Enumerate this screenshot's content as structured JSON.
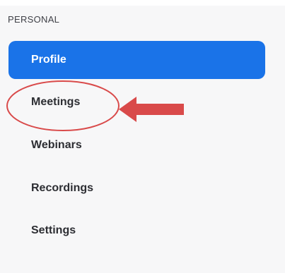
{
  "top_strip": {
    "faded_text": "··· · ········· ·· ··········· ·· ·· ···"
  },
  "sidebar": {
    "section_heading": "PERSONAL",
    "items": [
      {
        "label": "Profile",
        "active": true
      },
      {
        "label": "Meetings",
        "active": false
      },
      {
        "label": "Webinars",
        "active": false
      },
      {
        "label": "Recordings",
        "active": false
      },
      {
        "label": "Settings",
        "active": false
      }
    ]
  },
  "colors": {
    "accent": "#1a73e8",
    "annotation": "#d94a4a",
    "sidebar_background": "#f7f7f8"
  }
}
